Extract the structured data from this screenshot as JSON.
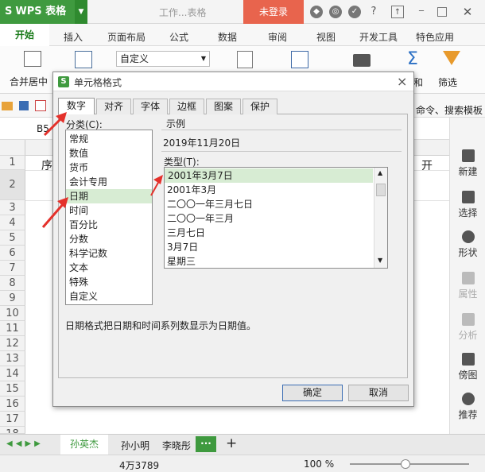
{
  "app": {
    "logo_text": "WPS 表格",
    "doc_title": "工作...表格",
    "login_label": "未登录"
  },
  "ribbon": {
    "tabs": [
      "开始",
      "插入",
      "页面布局",
      "公式",
      "数据",
      "审阅",
      "视图",
      "开发工具",
      "特色应用"
    ],
    "merge_center": "合并居中",
    "number_format": "自定义",
    "filter": "筛选",
    "sum_label": "和",
    "command_search": "命令、搜索模板"
  },
  "formula_bar": {
    "cell_ref": "B5"
  },
  "sheet": {
    "row_numbers": [
      "1",
      "2",
      "3",
      "4",
      "5",
      "6",
      "7",
      "8",
      "9",
      "10",
      "11",
      "12",
      "13",
      "14",
      "15",
      "16",
      "17",
      "18"
    ],
    "cell_b1": "序",
    "cell_right1": "开"
  },
  "right_panel": {
    "items": [
      "新建",
      "选择",
      "形状",
      "属性",
      "分析",
      "傍图",
      "推荐"
    ]
  },
  "sheet_tabs": {
    "tabs": [
      "孙英杰",
      "孙小明",
      "李晓彤"
    ],
    "more": "···",
    "add": "+"
  },
  "status": {
    "count": "4万3789",
    "zoom": "100 %"
  },
  "dialog": {
    "title": "单元格格式",
    "tabs": [
      "数字",
      "对齐",
      "字体",
      "边框",
      "图案",
      "保护"
    ],
    "category_label": "分类(C):",
    "categories": [
      "常规",
      "数值",
      "货币",
      "会计专用",
      "日期",
      "时间",
      "百分比",
      "分数",
      "科学记数",
      "文本",
      "特殊",
      "自定义"
    ],
    "selected_category": "日期",
    "sample_label": "示例",
    "sample_value": "2019年11月20日",
    "type_label": "类型(T):",
    "types": [
      "2001年3月7日",
      "2001年3月",
      "二〇〇一年三月七日",
      "二〇〇一年三月",
      "三月七日",
      "3月7日",
      "星期三"
    ],
    "description": "日期格式把日期和时间系列数显示为日期值。",
    "ok_label": "确定",
    "cancel_label": "取消",
    "close_glyph": "×"
  },
  "colors": {
    "accent_green": "#3f9a3f",
    "login_red": "#e8644d",
    "selection": "#d7ecd3",
    "arrow_red": "#e4312b"
  }
}
